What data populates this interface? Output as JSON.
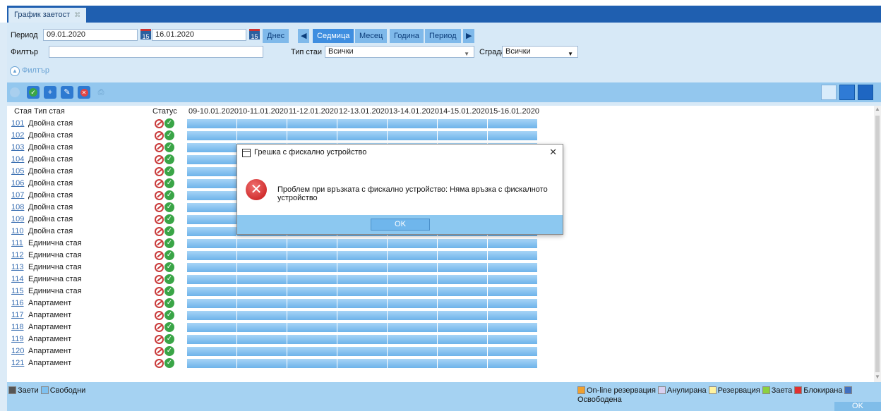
{
  "tab": {
    "title": "График заетост",
    "close": "⌘"
  },
  "filters": {
    "period_label": "Период",
    "date_from": "09.01.2020",
    "date_to": "16.01.2020",
    "cal_icon_text": "15",
    "filter_label": "Филтър",
    "filter_value": "",
    "room_type_label": "Тип стаи",
    "room_type_value": "Всички",
    "building_label": "Сграда",
    "building_value": "Всички",
    "toggle_label": "Филтър"
  },
  "nav": {
    "today": "Днес",
    "week": "Седмица",
    "month": "Месец",
    "year": "Година",
    "period": "Период",
    "prev": "◀",
    "next": "▶"
  },
  "grid": {
    "col_room": "Стая",
    "col_type": "Тип стая",
    "col_status": "Статус",
    "dates": [
      "09-10.01.2020",
      "10-11.01.2020",
      "11-12.01.2020",
      "12-13.01.2020",
      "13-14.01.2020",
      "14-15.01.2020",
      "15-16.01.2020"
    ],
    "rows": [
      {
        "room": "101",
        "type": "Двойна стая"
      },
      {
        "room": "102",
        "type": "Двойна стая"
      },
      {
        "room": "103",
        "type": "Двойна стая"
      },
      {
        "room": "104",
        "type": "Двойна стая"
      },
      {
        "room": "105",
        "type": "Двойна стая"
      },
      {
        "room": "106",
        "type": "Двойна стая"
      },
      {
        "room": "107",
        "type": "Двойна стая"
      },
      {
        "room": "108",
        "type": "Двойна стая"
      },
      {
        "room": "109",
        "type": "Двойна стая"
      },
      {
        "room": "110",
        "type": "Двойна стая"
      },
      {
        "room": "111",
        "type": "Единична стая"
      },
      {
        "room": "112",
        "type": "Единична стая"
      },
      {
        "room": "113",
        "type": "Единична стая"
      },
      {
        "room": "114",
        "type": "Единична стая"
      },
      {
        "room": "115",
        "type": "Единична стая"
      },
      {
        "room": "116",
        "type": "Апартамент"
      },
      {
        "room": "117",
        "type": "Апартамент"
      },
      {
        "room": "118",
        "type": "Апартамент"
      },
      {
        "room": "119",
        "type": "Апартамент"
      },
      {
        "room": "120",
        "type": "Апартамент"
      },
      {
        "room": "121",
        "type": "Апартамент"
      }
    ]
  },
  "legend_left": [
    {
      "label": "Заети",
      "color": "#555555"
    },
    {
      "label": "Свободни",
      "color": "#7fc1f0"
    }
  ],
  "legend_right": [
    {
      "label": "On-line резервация",
      "color": "#f0a030"
    },
    {
      "label": "Анулирана",
      "color": "#d8d0f0"
    },
    {
      "label": "Резервация",
      "color": "#fff3a0"
    },
    {
      "label": "Заета",
      "color": "#8cd040"
    },
    {
      "label": "Блокирана",
      "color": "#e03030"
    },
    {
      "label": "Освободена",
      "color": "#4070c0"
    }
  ],
  "bottom_ok": "OK",
  "dialog": {
    "title": "Грешка с фискално устройство",
    "close": "✕",
    "message": "Проблем при връзката с фискално устройство: Няма връзка с фискалното устройство",
    "ok": "OK"
  }
}
